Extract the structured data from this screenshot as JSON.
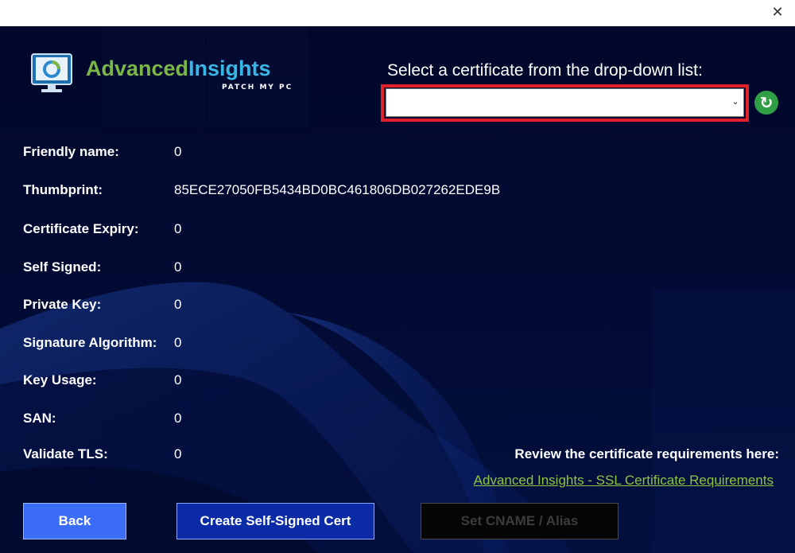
{
  "window": {
    "close_glyph": "✕"
  },
  "logo": {
    "word1": "Advanced",
    "word2": "Insights",
    "subtitle": "PATCH MY PC"
  },
  "certificate_select": {
    "label": "Select a certificate from the drop-down list:",
    "selected_value": "",
    "chevron_icon": "chevron-down-icon",
    "refresh_icon": "refresh-icon",
    "highlight_color": "#e2212b"
  },
  "fields": [
    {
      "label": "Friendly name:",
      "value": "0"
    },
    {
      "label": "Thumbprint:",
      "value": "85ECE27050FB5434BD0BC461806DB027262EDE9B"
    },
    {
      "label": "Certificate Expiry:",
      "value": "0"
    },
    {
      "label": "Self Signed:",
      "value": "0"
    },
    {
      "label": "Private Key:",
      "value": "0"
    },
    {
      "label": "Signature Algorithm:",
      "value": "0"
    },
    {
      "label": "Key Usage:",
      "value": "0"
    },
    {
      "label": "SAN:",
      "value": "0"
    },
    {
      "label": "Validate TLS:",
      "value": "0"
    }
  ],
  "requirements": {
    "text": "Review the certificate requirements here:",
    "link": "Advanced Insights - SSL Certificate Requirements"
  },
  "buttons": {
    "back": "Back",
    "create_self_signed": "Create Self-Signed Cert",
    "set_cname": "Set CNAME / Alias"
  },
  "colors": {
    "background": "#020a2e",
    "accent_green": "#8ec63f",
    "primary_button": "#3b6cf5",
    "secondary_button": "#0b2aa6",
    "disabled_button": "#050505"
  }
}
